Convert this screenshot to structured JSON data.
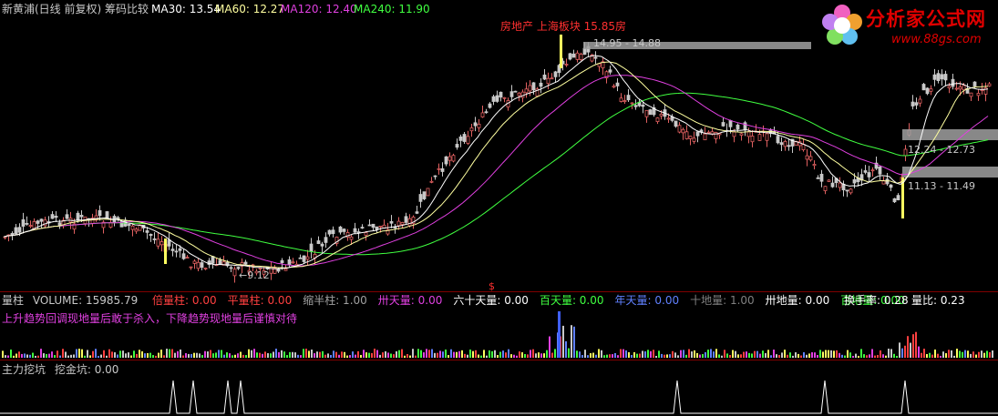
{
  "colors": {
    "background": "#000000",
    "up": "#e06060",
    "down": "#c8c8c8",
    "ma30": "#ffffff",
    "ma60": "#ffffa0",
    "ma120": "#e040e0",
    "ma240": "#40ff40",
    "alert": "#ff3030",
    "spike": "#ffffff"
  },
  "header": {
    "title": "新黄浦(日线 前复权) 筹码比较",
    "ma30": "MA30: 13.54",
    "ma60": "MA60: 12.27",
    "ma120": "MA120: 12.40",
    "ma240": "MA240: 11.90"
  },
  "logo": {
    "icon": "flower-logo-icon",
    "title": "分析家公式网",
    "url": "www.88gs.com"
  },
  "price_panel": {
    "top_annotation": "房地产 上海板块 15.85房",
    "chip_labels": [
      "14.95 - 14.88",
      "12.24 - 12.73",
      "11.13 - 11.49"
    ],
    "low_label": "←9.12",
    "marker": "$"
  },
  "volume_panel": {
    "title": "量柱",
    "volume": "VOLUME: 15985.79",
    "metrics": [
      {
        "label": "倍量柱:",
        "value": "0.00",
        "color": "#ff4040"
      },
      {
        "label": "平量柱:",
        "value": "0.00",
        "color": "#ff4040"
      },
      {
        "label": "缩半柱:",
        "value": "1.00",
        "color": "#a0a0a0"
      },
      {
        "label": "卅天量:",
        "value": "0.00",
        "color": "#e040e0"
      },
      {
        "label": "六十天量:",
        "value": "0.00",
        "color": "#ffffff"
      },
      {
        "label": "百天量:",
        "value": "0.00",
        "color": "#40ff40"
      },
      {
        "label": "年天量:",
        "value": "0.00",
        "color": "#6080ff"
      },
      {
        "label": "十地量:",
        "value": "1.00",
        "color": "#808080"
      },
      {
        "label": "卅地量:",
        "value": "0.00",
        "color": "#ffffff"
      },
      {
        "label": "百地量:",
        "value": "0.00",
        "color": "#40ff40"
      }
    ],
    "turnover": "换手率: 0.28",
    "volume_ratio": "量比: 0.23",
    "advice": "上升趋势回调现地量后敢于杀入，下降趋势现地量后谨慎对待"
  },
  "indicator_panel": {
    "title": "主力挖坑",
    "value": "挖金坑: 0.00"
  }
}
